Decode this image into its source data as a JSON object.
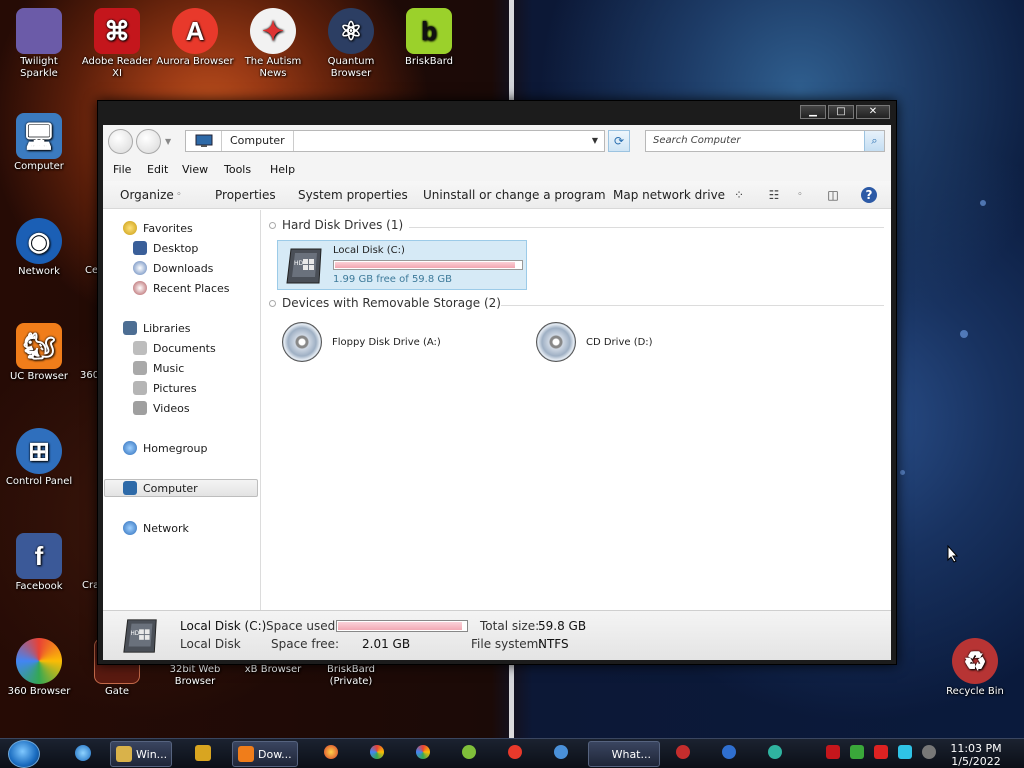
{
  "desktop": {
    "icons": [
      {
        "id": "twilight-sparkle",
        "label": "Twilight Sparkle",
        "color": "#6b5ba8",
        "glyph": ""
      },
      {
        "id": "adobe-reader",
        "label": "Adobe Reader XI",
        "color": "#c4161c",
        "glyph": ""
      },
      {
        "id": "aurora-browser",
        "label": "Aurora Browser",
        "color": "#e8392b",
        "glyph": "A"
      },
      {
        "id": "autism-news",
        "label": "The Autism News",
        "color": "#f2f2f2",
        "glyph": ""
      },
      {
        "id": "quantum-browser",
        "label": "Quantum Browser",
        "color": "#2c3e63",
        "glyph": ""
      },
      {
        "id": "briskbard",
        "label": "BriskBard",
        "color": "#9bd12b",
        "glyph": "b"
      },
      {
        "id": "computer",
        "label": "Computer",
        "color": "#3b7bc0",
        "glyph": ""
      },
      {
        "id": "network",
        "label": "Network",
        "color": "#1b5fb5",
        "glyph": ""
      },
      {
        "id": "partial-ce",
        "label": "Ce",
        "color": "#555555",
        "glyph": ""
      },
      {
        "id": "uc-browser",
        "label": "UC Browser",
        "color": "#f07d1a",
        "glyph": ""
      },
      {
        "id": "partial-360",
        "label": "360",
        "color": "#3a9a3a",
        "glyph": ""
      },
      {
        "id": "control-panel",
        "label": "Control Panel",
        "color": "#2f6fbd",
        "glyph": ""
      },
      {
        "id": "facebook",
        "label": "Facebook",
        "color": "#3b5998",
        "glyph": "f"
      },
      {
        "id": "partial-cra",
        "label": "Cra",
        "color": "#666666",
        "glyph": ""
      },
      {
        "id": "browser-360",
        "label": "360 Browser",
        "color": "#e94235",
        "glyph": ""
      },
      {
        "id": "gate",
        "label": "Gate",
        "color": "#5a1a10",
        "glyph": ""
      },
      {
        "id": "32bit-web-browser",
        "label": "32bit Web Browser",
        "color": "#1f62c2",
        "glyph": ""
      },
      {
        "id": "xb-browser",
        "label": "xB Browser",
        "color": "#3a6bb0",
        "glyph": ""
      },
      {
        "id": "briskbard-private",
        "label": "BriskBard (Private)",
        "color": "#9bd12b",
        "glyph": "b"
      },
      {
        "id": "recycle-bin",
        "label": "Recycle Bin",
        "color": "#b73434",
        "glyph": ""
      }
    ]
  },
  "window": {
    "address": {
      "crumb": "Computer",
      "icon": "computer-icon"
    },
    "search": {
      "placeholder": "Search Computer",
      "icon": "search-icon"
    },
    "menu": [
      "File",
      "Edit",
      "View",
      "Tools",
      "Help"
    ],
    "toolbar": {
      "organize": "Organize",
      "properties": "Properties",
      "system_properties": "System properties",
      "uninstall": "Uninstall or change a program",
      "map_drive": "Map network drive"
    },
    "nav": {
      "favorites": "Favorites",
      "desktop": "Desktop",
      "downloads": "Downloads",
      "recent": "Recent Places",
      "libraries": "Libraries",
      "documents": "Documents",
      "music": "Music",
      "pictures": "Pictures",
      "videos": "Videos",
      "homegroup": "Homegroup",
      "computer": "Computer",
      "network": "Network"
    },
    "groups": {
      "hard_disks": "Hard Disk Drives (1)",
      "removable": "Devices with Removable Storage (2)"
    },
    "drives": {
      "local": {
        "name": "Local Disk (C:)",
        "free_text": "1.99 GB free of 59.8 GB",
        "used_fraction": 0.967
      },
      "floppy": {
        "name": "Floppy Disk Drive (A:)"
      },
      "cd": {
        "name": "CD Drive (D:)"
      }
    },
    "details": {
      "name": "Local Disk (C:)",
      "type": "Local Disk",
      "space_used_label": "Space used:",
      "space_free_label": "Space free:",
      "space_free_value": "2.01 GB",
      "total_size_label": "Total size:",
      "total_size_value": "59.8 GB",
      "filesystem_label": "File system:",
      "filesystem_value": "NTFS",
      "used_fraction": 0.967
    },
    "accent": "#9ccbe8",
    "bar_color": "#f2a5b0"
  },
  "taskbar": {
    "items": [
      {
        "id": "win-explorer",
        "label": "Win...",
        "color": "#d9b24a"
      },
      {
        "id": "media",
        "label": "",
        "color": "#d9a520"
      },
      {
        "id": "dow",
        "label": "Dow...",
        "color": "#f07d1a"
      },
      {
        "id": "what",
        "label": "What...",
        "color": "#2a2a2a"
      }
    ],
    "clock": {
      "time": "11:03 PM",
      "date": "1/5/2022"
    }
  }
}
